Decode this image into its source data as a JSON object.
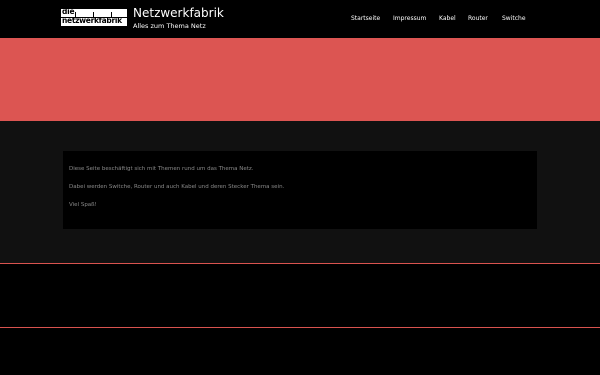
{
  "site": {
    "title": "Netzwerkfabrik",
    "tagline": "Alles zum Thema Netz",
    "logo_line1": "die",
    "logo_line2": "netzwerkfabrik"
  },
  "nav": {
    "items": [
      {
        "label": "Startseite"
      },
      {
        "label": "Impressum"
      },
      {
        "label": "Kabel"
      },
      {
        "label": "Router"
      },
      {
        "label": "Switche"
      }
    ]
  },
  "content": {
    "paragraphs": [
      "Diese Seite beschäftigt sich mit Themen rund um das Thema Netz.",
      "Dabei werden Switche, Router und auch Kabel und deren Stecker Thema sein.",
      "Viel Spaß!"
    ]
  },
  "colors": {
    "accent": "#dc5552",
    "background": "#000000",
    "section_bg": "#111111"
  }
}
